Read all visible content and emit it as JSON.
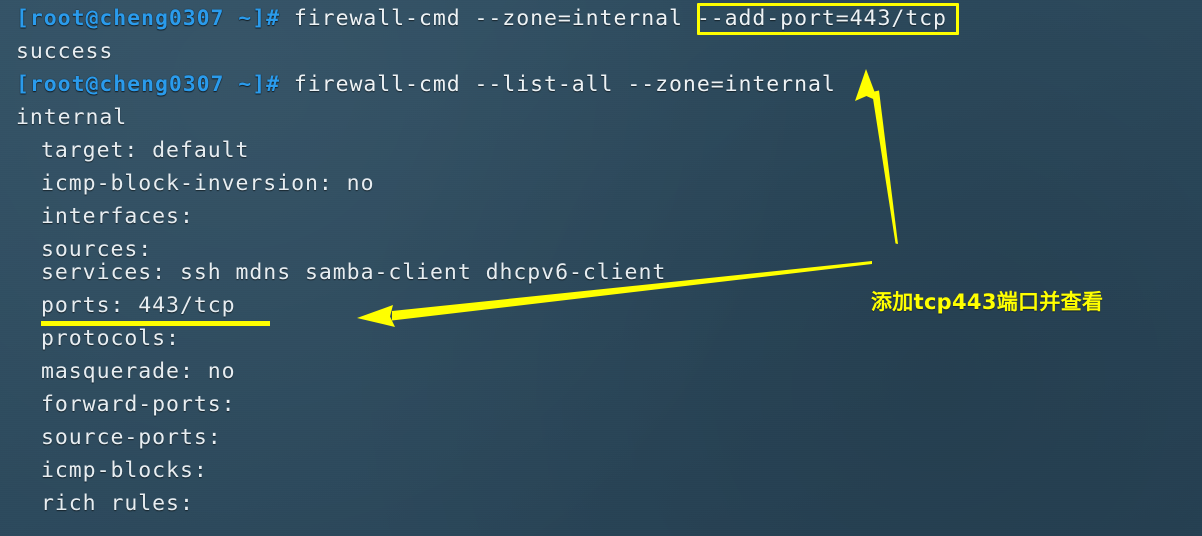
{
  "terminal": {
    "background_color": "#2c4a5d",
    "text_color": "#e8eef2",
    "prompt_color": "#2a9bec",
    "accent_color": "#ffff00",
    "hostname": "cheng0307",
    "user": "root",
    "lines": [
      {
        "type": "command",
        "prompt": "[root@cheng0307 ~]# ",
        "command": "firewall-cmd --zone=internal --add-port=443/tcp"
      },
      {
        "type": "output",
        "text": "success"
      },
      {
        "type": "command",
        "prompt": "[root@cheng0307 ~]# ",
        "command": "firewall-cmd --list-all --zone=internal"
      },
      {
        "type": "output",
        "text": "internal"
      },
      {
        "type": "output-indent",
        "text": "target: default"
      },
      {
        "type": "output-indent",
        "text": "icmp-block-inversion: no"
      },
      {
        "type": "output-indent",
        "text": "interfaces:"
      },
      {
        "type": "output-indent",
        "text": "sources:"
      },
      {
        "type": "output-indent",
        "text": "services: ssh mdns samba-client dhcpv6-client"
      },
      {
        "type": "output-indent",
        "text": "ports: 443/tcp"
      },
      {
        "type": "output-indent",
        "text": "protocols:"
      },
      {
        "type": "output-indent",
        "text": "masquerade: no"
      },
      {
        "type": "output-indent",
        "text": "forward-ports:"
      },
      {
        "type": "output-indent",
        "text": "source-ports:"
      },
      {
        "type": "output-indent",
        "text": "icmp-blocks:"
      },
      {
        "type": "output-indent",
        "text": "rich rules:"
      }
    ]
  },
  "annotations": {
    "note_text": "添加tcp443端口并查看",
    "note_color": "#ffff00",
    "highlight_box_target": "--add-port=443/tcp",
    "underline_target": "ports: 443/tcp",
    "arrow_up_label": "arrow-to-add-port-option",
    "arrow_left_label": "arrow-to-ports-line"
  }
}
